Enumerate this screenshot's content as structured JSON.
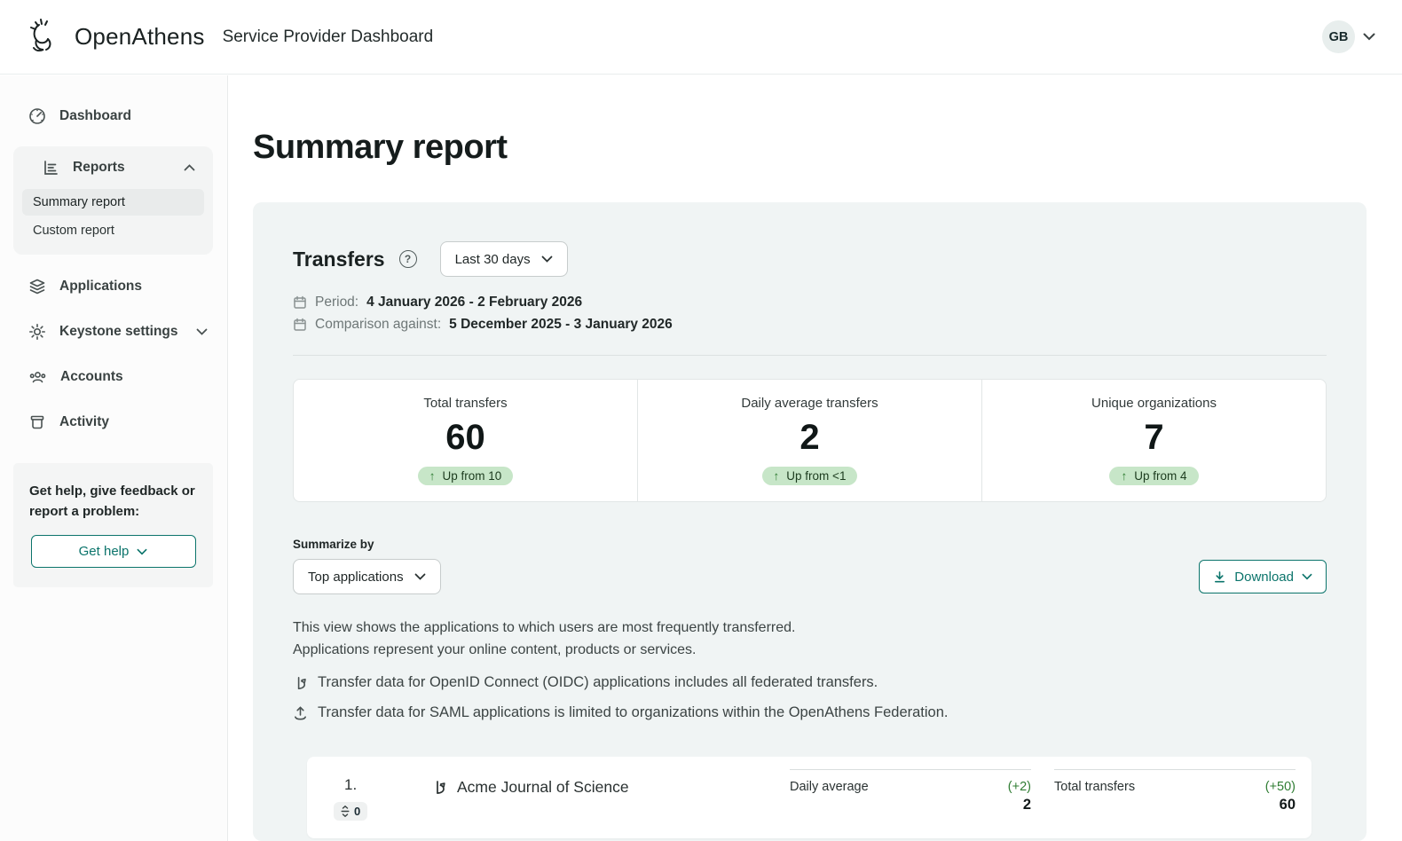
{
  "header": {
    "brand": "OpenAthens",
    "app_title": "Service Provider Dashboard",
    "avatar": "GB"
  },
  "sidebar": {
    "dashboard": "Dashboard",
    "reports": {
      "label": "Reports",
      "sub": [
        "Summary report",
        "Custom report"
      ]
    },
    "applications": "Applications",
    "keystone": "Keystone settings",
    "accounts": "Accounts",
    "activity": "Activity",
    "help": {
      "text": "Get help, give feedback or report a problem:",
      "button": "Get help"
    }
  },
  "main": {
    "title": "Summary report",
    "transfers": {
      "heading": "Transfers",
      "range_button": "Last 30 days",
      "period_label": "Period:",
      "period_value": "4 January 2026 - 2 February 2026",
      "comparison_label": "Comparison against:",
      "comparison_value": "5 December 2025 - 3 January 2026"
    },
    "stats": {
      "cards": [
        {
          "label": "Total transfers",
          "value": "60",
          "badge": "Up from 10"
        },
        {
          "label": "Daily average transfers",
          "value": "2",
          "badge": "Up from <1"
        },
        {
          "label": "Unique organizations",
          "value": "7",
          "badge": "Up from 4"
        }
      ]
    },
    "summarize": {
      "label": "Summarize by",
      "selected": "Top applications"
    },
    "download_label": "Download",
    "description": [
      "This view shows the applications to which users are most frequently transferred.",
      "Applications represent your online content, products or services."
    ],
    "notes": [
      {
        "icon": "oidc-icon",
        "text": "Transfer data for OpenID Connect (OIDC) applications includes all federated transfers."
      },
      {
        "icon": "saml-upload-icon",
        "text": "Transfer data for SAML applications is limited to organizations within the OpenAthens Federation."
      }
    ],
    "row": {
      "rank": "1.",
      "rank_change": "0",
      "name": "Acme Journal of Science",
      "metrics": [
        {
          "label": "Daily average",
          "delta": "(+2)",
          "value": "2"
        },
        {
          "label": "Total transfers",
          "delta": "(+50)",
          "value": "60"
        }
      ]
    }
  },
  "icons": {
    "up_arrow": "↑",
    "help": "?"
  },
  "colors": {
    "teal_accent": "#0b746b",
    "badge_bg": "#c7e6c8",
    "delta_green": "#2f7d33",
    "panel_bg": "#f0f4f4"
  }
}
